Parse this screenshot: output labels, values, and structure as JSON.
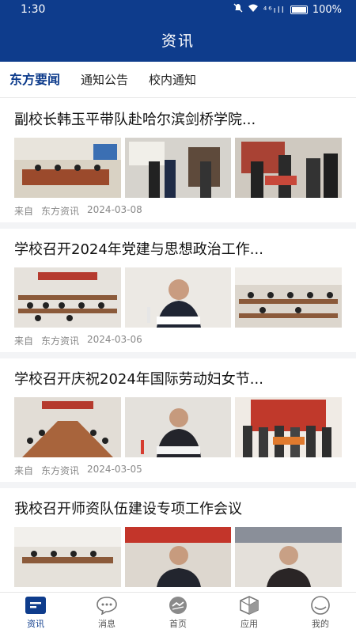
{
  "status": {
    "time": "1:30",
    "signal": "⁴⁶ıll",
    "battery": "100%"
  },
  "header": {
    "title": "资讯"
  },
  "tabs": [
    {
      "label": "东方要闻",
      "active": true
    },
    {
      "label": "通知公告",
      "active": false
    },
    {
      "label": "校内通知",
      "active": false
    }
  ],
  "articles": [
    {
      "title": "副校长韩玉平带队赴哈尔滨剑桥学院...",
      "from_label": "来自",
      "source": "东方资讯",
      "date": "2024-03-08"
    },
    {
      "title": "学校召开2024年党建与思想政治工作...",
      "from_label": "来自",
      "source": "东方资讯",
      "date": "2024-03-06"
    },
    {
      "title": "学校召开庆祝2024年国际劳动妇女节...",
      "from_label": "来自",
      "source": "东方资讯",
      "date": "2024-03-05"
    },
    {
      "title": "我校召开师资队伍建设专项工作会议",
      "from_label": "",
      "source": "",
      "date": ""
    }
  ],
  "bottom_nav": [
    {
      "label": "资讯",
      "icon": "news-icon",
      "active": true
    },
    {
      "label": "消息",
      "icon": "chat-bubble-icon",
      "active": false
    },
    {
      "label": "首页",
      "icon": "home-logo-icon",
      "active": false
    },
    {
      "label": "应用",
      "icon": "cube-icon",
      "active": false
    },
    {
      "label": "我的",
      "icon": "profile-icon",
      "active": false
    }
  ],
  "colors": {
    "primary": "#0e3c8c",
    "muted": "#888888",
    "divider": "#f3f4f6"
  }
}
